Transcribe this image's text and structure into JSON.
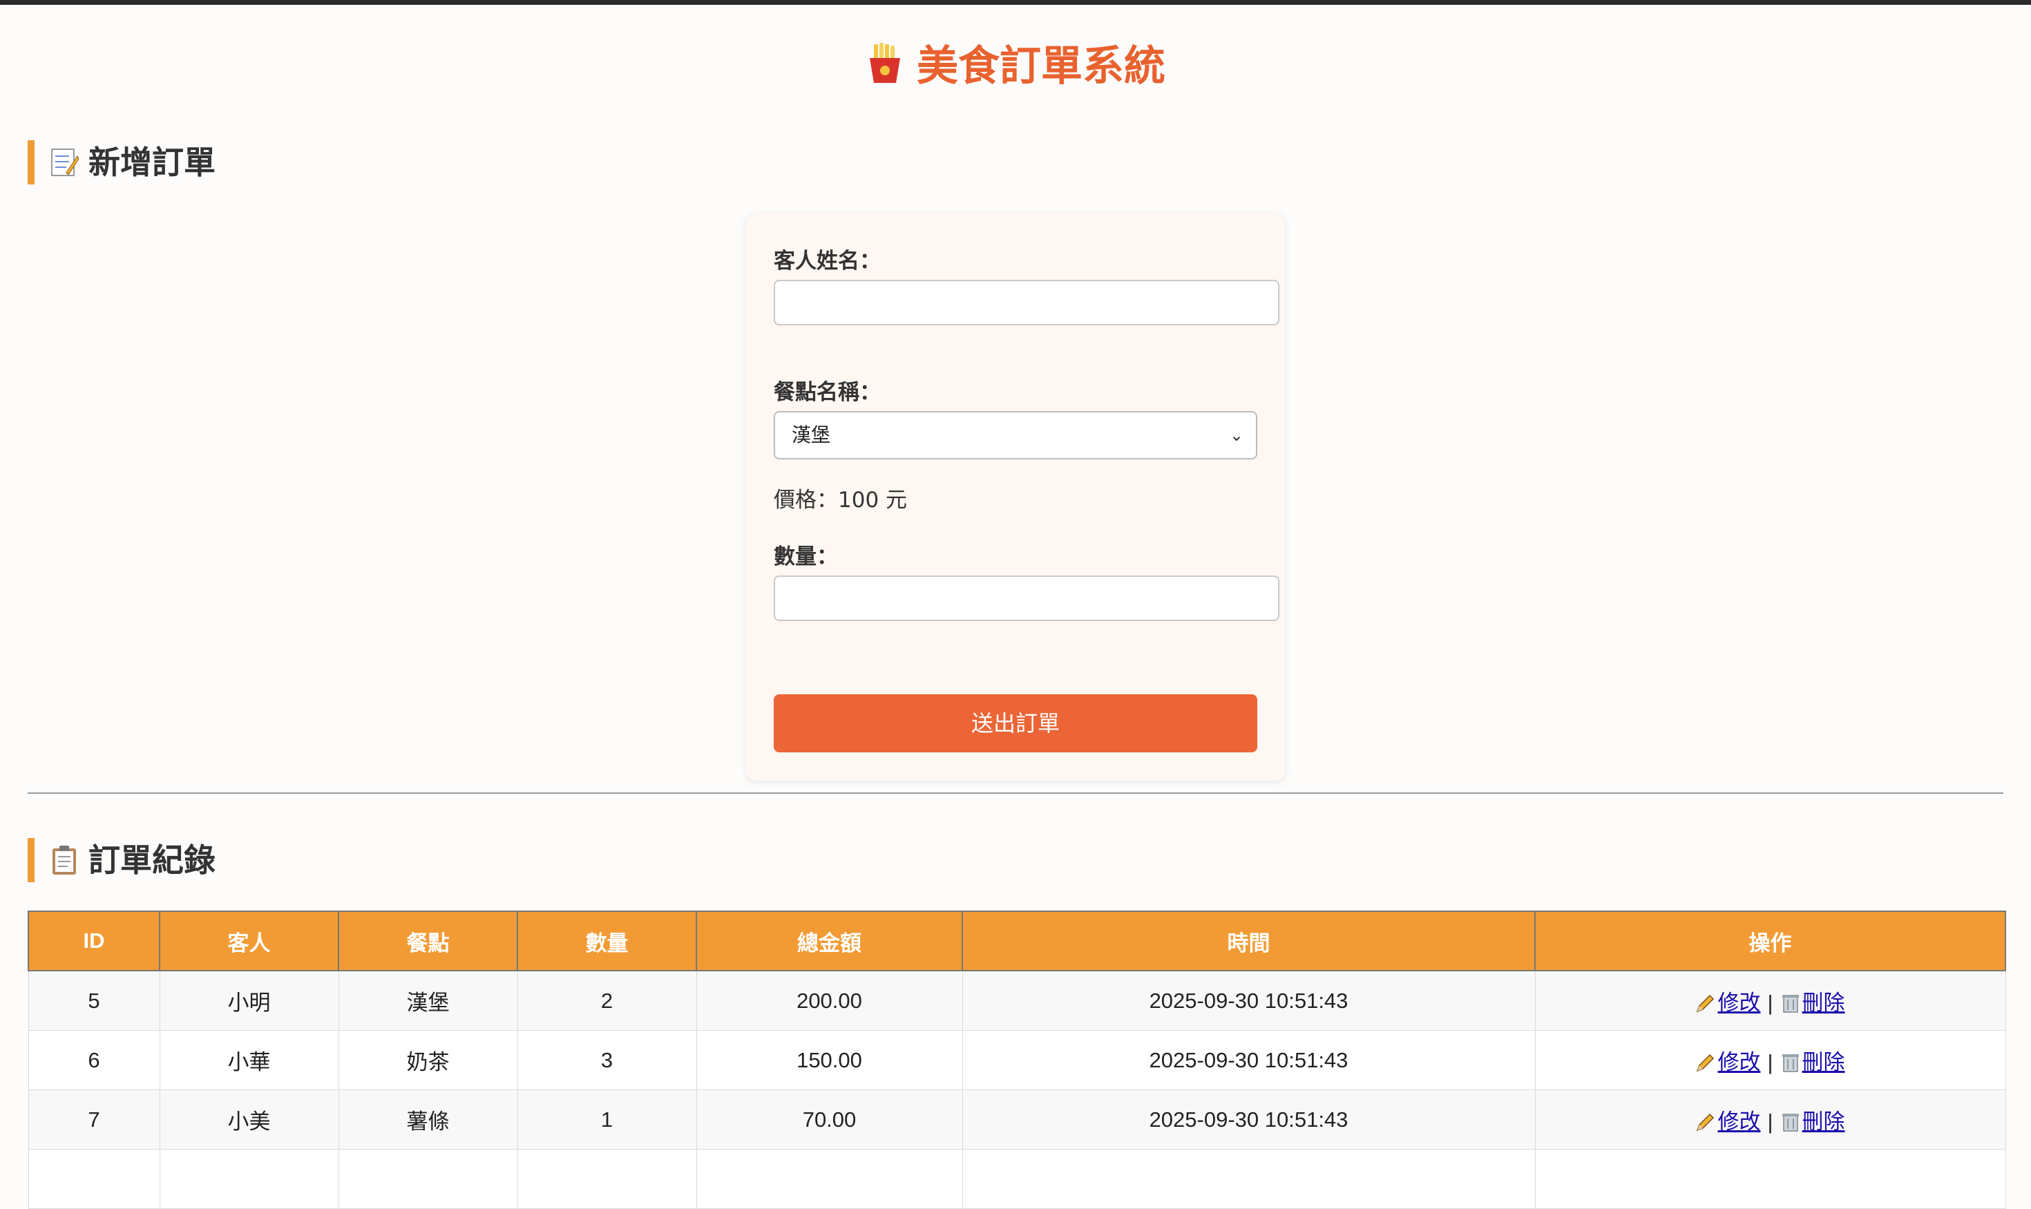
{
  "page": {
    "title": "美食訂單系統",
    "title_icon": "fries-icon"
  },
  "new_order": {
    "heading": "新增訂單",
    "heading_icon": "memo-icon",
    "customer_label": "客人姓名：",
    "customer_value": "",
    "dish_label": "餐點名稱：",
    "dish_selected": "漢堡",
    "price_text": "價格：100 元",
    "quantity_label": "數量：",
    "quantity_value": "",
    "submit_label": "送出訂單"
  },
  "records": {
    "heading": "訂單紀錄",
    "heading_icon": "clipboard-icon",
    "columns": [
      "ID",
      "客人",
      "餐點",
      "數量",
      "總金額",
      "時間",
      "操作"
    ],
    "rows": [
      {
        "id": "5",
        "customer": "小明",
        "dish": "漢堡",
        "qty": "2",
        "total": "200.00",
        "time": "2025-09-30 10:51:43",
        "edit": "修改",
        "sep": "|",
        "delete": "刪除"
      },
      {
        "id": "6",
        "customer": "小華",
        "dish": "奶茶",
        "qty": "3",
        "total": "150.00",
        "time": "2025-09-30 10:51:43",
        "edit": "修改",
        "sep": "|",
        "delete": "刪除"
      },
      {
        "id": "7",
        "customer": "小美",
        "dish": "薯條",
        "qty": "1",
        "total": "70.00",
        "time": "2025-09-30 10:51:43",
        "edit": "修改",
        "sep": "|",
        "delete": "刪除"
      }
    ]
  },
  "colors": {
    "accent": "#e8622f",
    "header_bg": "#f29b35",
    "button": "#ec6536"
  }
}
